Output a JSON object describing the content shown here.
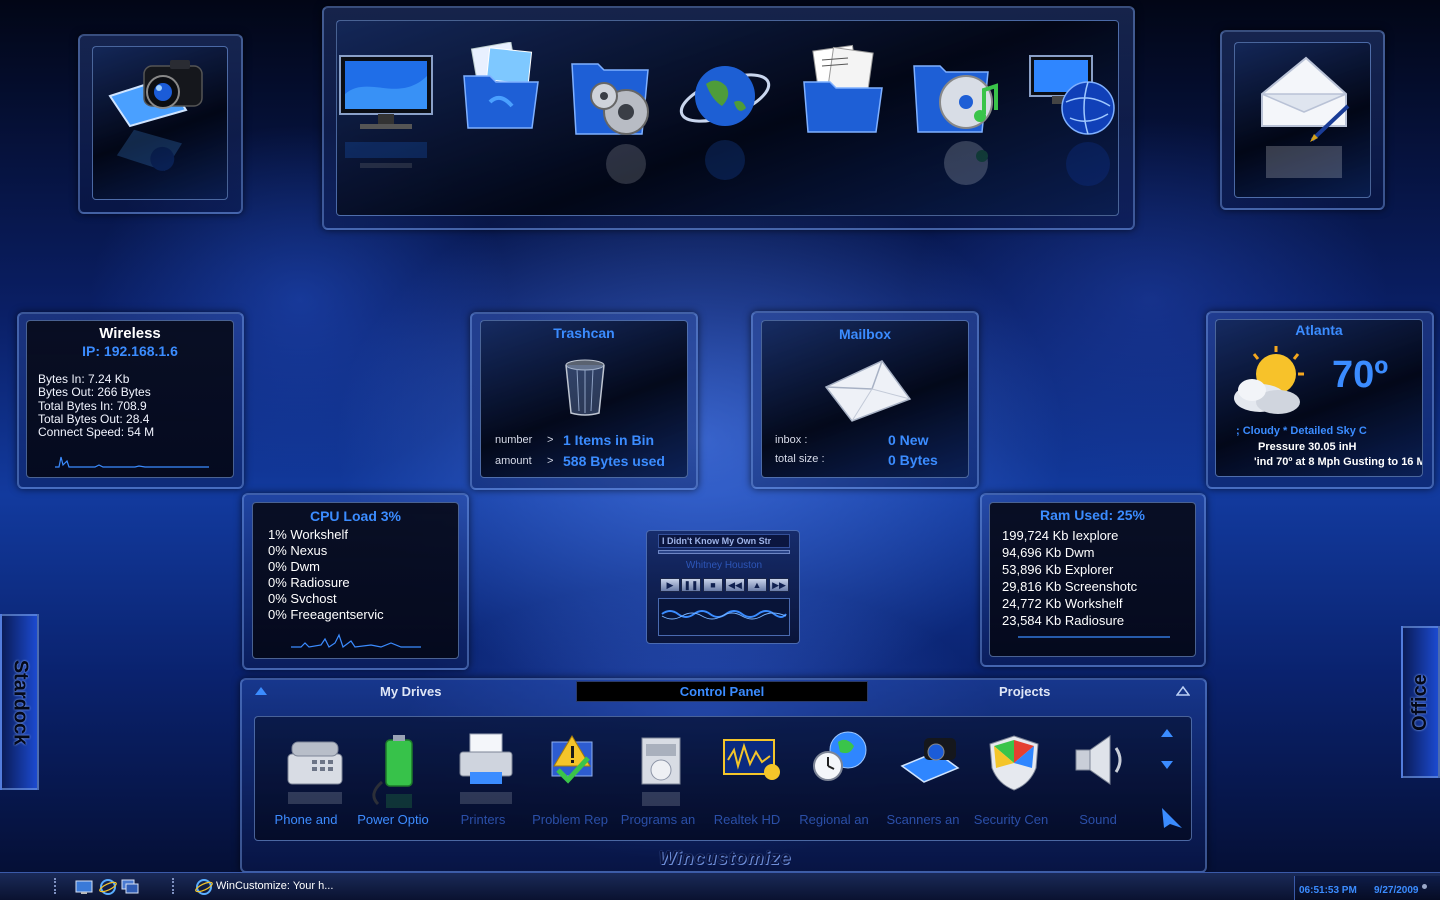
{
  "wireless": {
    "title": "Wireless",
    "ip": "IP: 192.168.1.6",
    "bytes_in": "Bytes In: 7.24 Kb",
    "bytes_out": "Bytes Out: 266 Bytes",
    "total_in": "Total Bytes In: 708.9",
    "total_out": "Total Bytes Out: 28.4",
    "speed": "Connect Speed: 54 M"
  },
  "trashcan": {
    "title": "Trashcan",
    "number_label": "number",
    "number_arrow": ">",
    "number_value": "1 Items in Bin",
    "amount_label": "amount",
    "amount_arrow": ">",
    "amount_value": "588 Bytes used"
  },
  "mailbox": {
    "title": "Mailbox",
    "inbox_label": "inbox :",
    "inbox_value": "0 New",
    "size_label": "total size :",
    "size_value": "0 Bytes"
  },
  "weather": {
    "city": "Atlanta",
    "temp": "70º",
    "condition": "; Cloudy * Detailed Sky C",
    "pressure": "Pressure 30.05 inH",
    "wind": "'ind 70º at 8 Mph Gusting to 16 M"
  },
  "cpu": {
    "title": "CPU Load 3%",
    "processes": [
      "1% Workshelf",
      "0% Nexus",
      "0% Dwm",
      "0% Radiosure",
      "0% Svchost",
      "0% Freeagentservic"
    ]
  },
  "ram": {
    "title": "Ram Used: 25%",
    "processes": [
      "199,724 Kb Iexplore",
      "94,696 Kb Dwm",
      "53,896 Kb Explorer",
      "29,816 Kb Screenshotc",
      "24,772 Kb Workshelf",
      "23,584 Kb Radiosure"
    ]
  },
  "media": {
    "track": "I Didn't Know My Own Str",
    "status": "Whitney Houston",
    "buttons": [
      "▶",
      "❚❚",
      "■",
      "◀◀",
      "▲",
      "▶▶"
    ]
  },
  "dock": {
    "tab_left": "My Drives",
    "tab_center": "Control Panel",
    "tab_right": "Projects",
    "brand": "Wincustomize",
    "items": [
      {
        "label": "Phone and",
        "icon": "phone-icon"
      },
      {
        "label": "Power Optio",
        "icon": "battery-icon"
      },
      {
        "label": "Printers",
        "icon": "printer-icon"
      },
      {
        "label": "Problem Rep",
        "icon": "problem-report-icon"
      },
      {
        "label": "Programs an",
        "icon": "programs-icon"
      },
      {
        "label": "Realtek HD",
        "icon": "audio-wave-icon"
      },
      {
        "label": "Regional an",
        "icon": "globe-clock-icon"
      },
      {
        "label": "Scanners an",
        "icon": "scanner-icon"
      },
      {
        "label": "Security Cen",
        "icon": "shield-icon"
      },
      {
        "label": "Sound",
        "icon": "speaker-icon"
      }
    ]
  },
  "side_tabs": {
    "left": "Stardock",
    "right": "Office"
  },
  "taskbar": {
    "window_title": "WinCustomize: Your h...",
    "time": "06:51:53 PM",
    "date": "9/27/2009"
  },
  "colors": {
    "accent": "#3b8cff",
    "panel_bg": "#05091c",
    "border": "#7ca4e6"
  }
}
